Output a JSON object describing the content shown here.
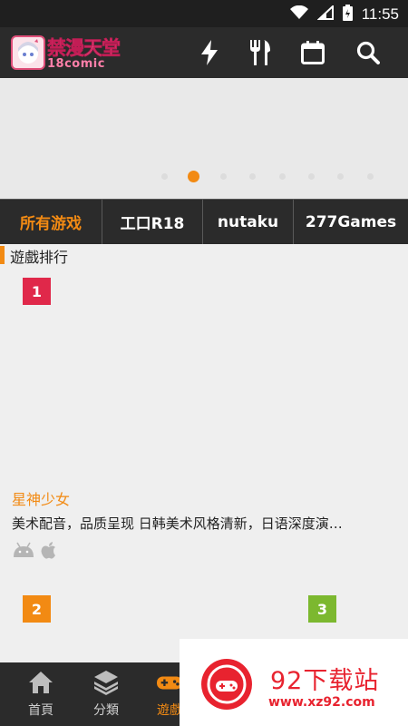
{
  "status_bar": {
    "time": "11:55"
  },
  "app_bar": {
    "logo_title": "禁漫天堂",
    "logo_subtitle": "18comic",
    "actions": [
      "flash-icon",
      "utensils-icon",
      "calendar-icon",
      "search-icon"
    ]
  },
  "carousel": {
    "dot_count": 8,
    "active_index": 1
  },
  "tabs": [
    {
      "label": "所有游戏",
      "active": true
    },
    {
      "label": "工口R18",
      "active": false
    },
    {
      "label": "nutaku",
      "active": false
    },
    {
      "label": "277Games",
      "active": false
    }
  ],
  "section": {
    "title": "遊戲排行"
  },
  "ranks": [
    {
      "number": "1",
      "color": "#e0284a"
    },
    {
      "number": "2",
      "color": "#f28a13"
    },
    {
      "number": "3",
      "color": "#7cb82f"
    }
  ],
  "featured_game": {
    "name": "星神少女",
    "description": "美术配音，品质呈现 日韩美术风格清新，日语深度演…",
    "platforms": [
      "android-icon",
      "apple-icon"
    ]
  },
  "bottom_nav": [
    {
      "label": "首頁",
      "icon": "home-icon",
      "active": false
    },
    {
      "label": "分類",
      "icon": "layers-icon",
      "active": false
    },
    {
      "label": "遊戲",
      "icon": "gamepad-icon",
      "active": true
    }
  ],
  "watermark": {
    "title": "92下载站",
    "url": "www.xz92.com"
  },
  "colors": {
    "accent": "#f28a13",
    "bar": "#2b2b2b",
    "rank1": "#e0284a",
    "rank2": "#f28a13",
    "rank3": "#7cb82f",
    "watermark": "#e8232f"
  }
}
